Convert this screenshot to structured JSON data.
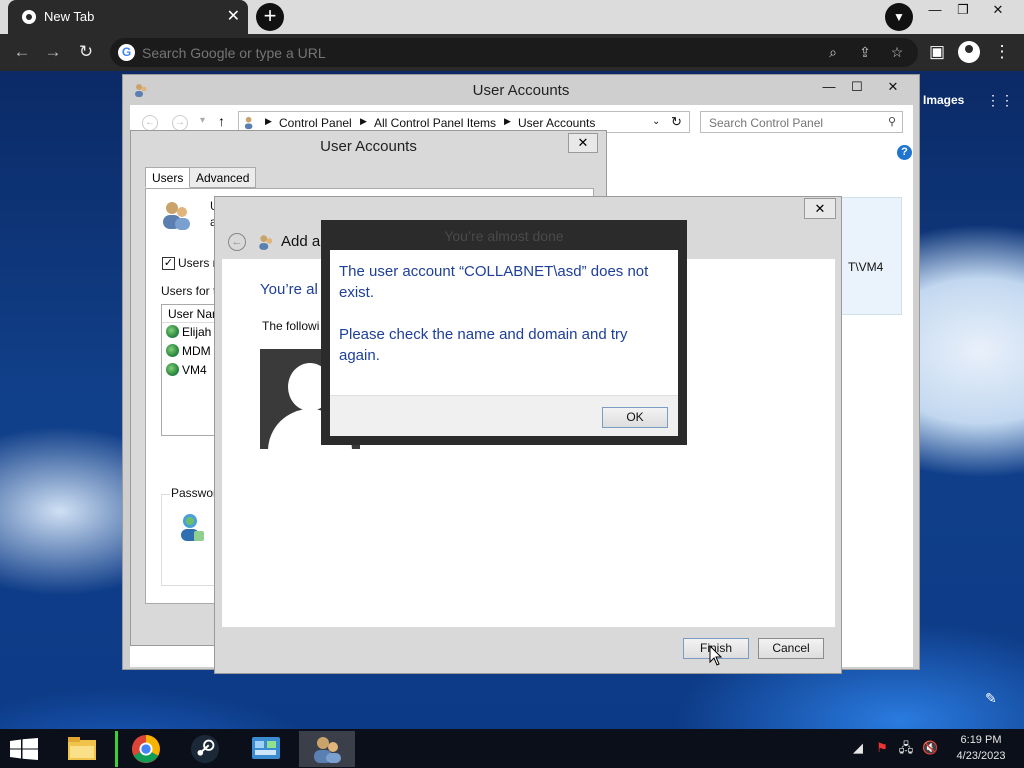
{
  "browser": {
    "tab_title": "New Tab",
    "omnibox_placeholder": "Search Google or type a URL"
  },
  "ntp": {
    "images_link": "Images"
  },
  "ua_main": {
    "title": "User Accounts",
    "breadcrumbs": [
      "Control Panel",
      "All Control Panel Items",
      "User Accounts"
    ],
    "search_placeholder": "Search Control Panel",
    "help": "?",
    "bg_vm4": "T\\VM4"
  },
  "ua_dialog": {
    "title": "User Accounts",
    "tabs": [
      "Users",
      "Advanced"
    ],
    "line1": "U",
    "line2": "a",
    "checkbox_label": "Users m",
    "users_for": "Users for t",
    "list_header": "User Nar",
    "users": [
      "Elijah",
      "MDM",
      "VM4"
    ],
    "password_group": "Passwor"
  },
  "wizard": {
    "title": "Add a",
    "heading": "You’re al",
    "desc": "The followi",
    "finish_label": "Finish",
    "cancel_label": "Cancel"
  },
  "error_dialog": {
    "title": "You’re almost done",
    "message1": "The user account “COLLABNET\\asd” does not exist.",
    "message2": "Please check the name and domain and try again.",
    "ok_label": "OK"
  },
  "taskbar": {
    "time": "6:19 PM",
    "date": "4/23/2023"
  },
  "colors": {
    "accent_blue": "#1e3f9a",
    "chrome_dark": "#2a2a2a"
  }
}
